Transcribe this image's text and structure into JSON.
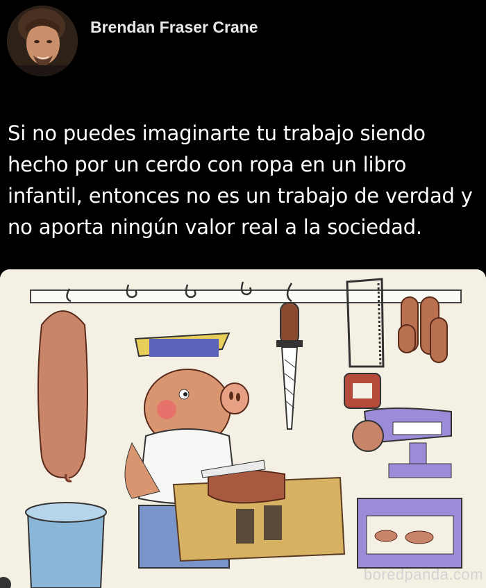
{
  "post": {
    "author_name": "Brendan Fraser Crane",
    "text": "Si no puedes imaginarte tu trabajo siendo hecho por un cerdo con ropa en un libro infantil, entonces no es un trabajo de verdad y no aporta ningún valor real a la sociedad."
  },
  "image": {
    "watermark": "boredpanda.com",
    "icon": "butcher-pig-illustration"
  },
  "colors": {
    "background": "#000000",
    "text": "#ffffff",
    "author": "#e9e9e9"
  }
}
